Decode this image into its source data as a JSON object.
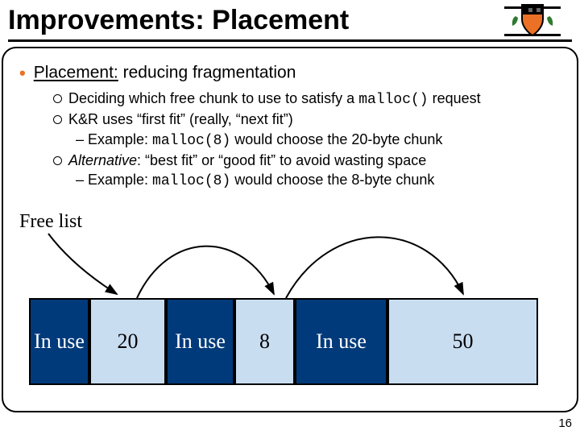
{
  "title": "Improvements: Placement",
  "bullet1_leader": "Placement:",
  "bullet1_rest": " reducing fragmentation",
  "sub1_a": "Deciding which free chunk to use to satisfy a ",
  "sub1_code": "malloc()",
  "sub1_b": " request",
  "sub2": "K&R uses “first fit” (really, “next fit”)",
  "sub2_ex_a": "– Example: ",
  "sub2_ex_code": "malloc(8)",
  "sub2_ex_b": " would choose the 20-byte chunk",
  "sub3_i": "Alternative",
  "sub3_b": ": “best fit” or “good fit” to avoid wasting space",
  "sub3_ex_a": "– Example: ",
  "sub3_ex_code": "malloc(8)",
  "sub3_ex_b": " would choose the 8-byte chunk",
  "free_list_label": "Free list",
  "blocks": {
    "b0": "In use",
    "b1": "20",
    "b2": "In use",
    "b3": "8",
    "b4": "In use",
    "b5": "50"
  },
  "page_number": "16"
}
